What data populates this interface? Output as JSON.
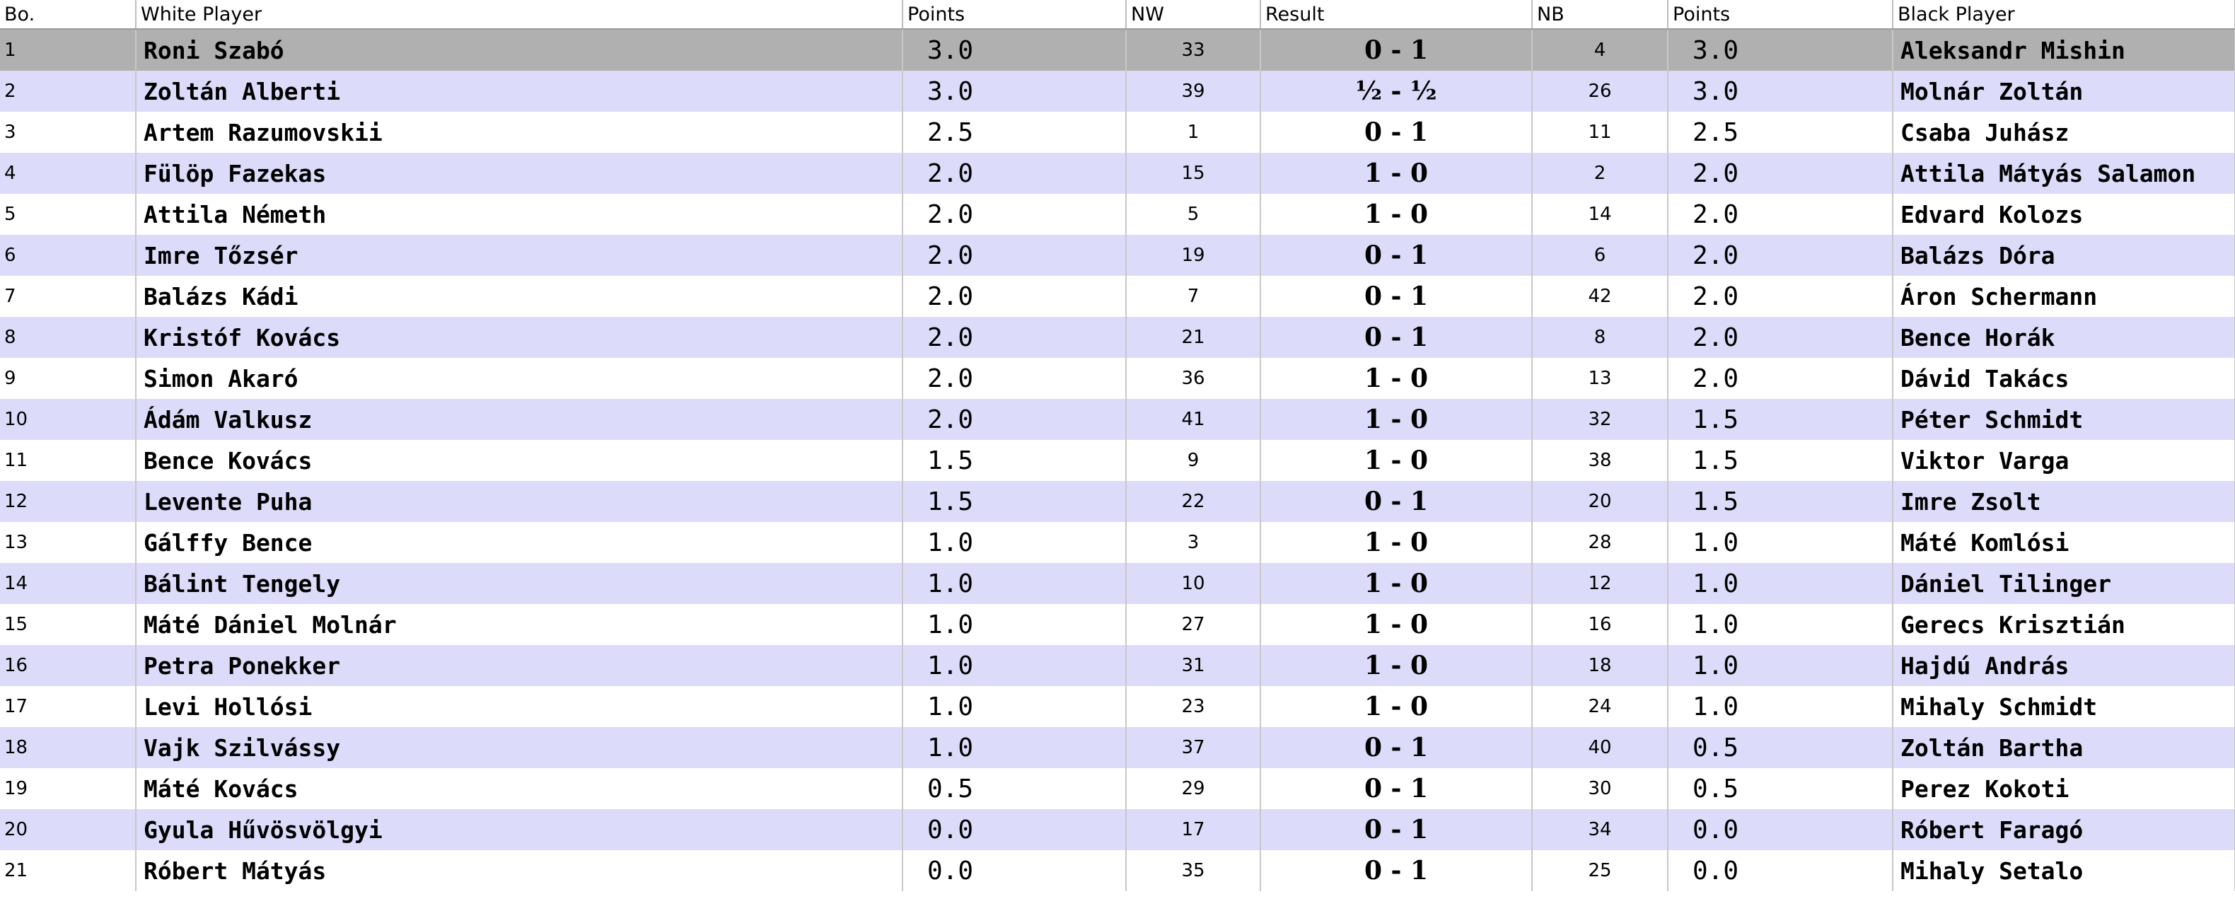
{
  "columns": {
    "board": "Bo.",
    "white_player": "White Player",
    "white_points": "Points",
    "nw": "NW",
    "result": "Result",
    "nb": "NB",
    "black_points": "Points",
    "black_player": "Black Player"
  },
  "selected_row": 0,
  "colors": {
    "row_odd": "#ffffff",
    "row_even": "#dcdcfa",
    "row_selected": "#b0b0b0",
    "grid": "#c8c8c8"
  },
  "rows": [
    {
      "board": "1",
      "white": "Roni Szabó",
      "white_points": "3.0",
      "nw": "33",
      "result": "0 - 1",
      "nb": "4",
      "black_points": "3.0",
      "black": "Aleksandr Mishin"
    },
    {
      "board": "2",
      "white": "Zoltán Alberti",
      "white_points": "3.0",
      "nw": "39",
      "result": "½ - ½",
      "nb": "26",
      "black_points": "3.0",
      "black": "Molnár Zoltán"
    },
    {
      "board": "3",
      "white": "Artem Razumovskii",
      "white_points": "2.5",
      "nw": "1",
      "result": "0 - 1",
      "nb": "11",
      "black_points": "2.5",
      "black": "Csaba Juhász"
    },
    {
      "board": "4",
      "white": "Fülöp Fazekas",
      "white_points": "2.0",
      "nw": "15",
      "result": "1 - 0",
      "nb": "2",
      "black_points": "2.0",
      "black": "Attila Mátyás Salamon"
    },
    {
      "board": "5",
      "white": "Attila Németh",
      "white_points": "2.0",
      "nw": "5",
      "result": "1 - 0",
      "nb": "14",
      "black_points": "2.0",
      "black": "Edvard Kolozs"
    },
    {
      "board": "6",
      "white": "Imre Tőzsér",
      "white_points": "2.0",
      "nw": "19",
      "result": "0 - 1",
      "nb": "6",
      "black_points": "2.0",
      "black": "Balázs Dóra"
    },
    {
      "board": "7",
      "white": "Balázs Kádi",
      "white_points": "2.0",
      "nw": "7",
      "result": "0 - 1",
      "nb": "42",
      "black_points": "2.0",
      "black": "Áron Schermann"
    },
    {
      "board": "8",
      "white": "Kristóf Kovács",
      "white_points": "2.0",
      "nw": "21",
      "result": "0 - 1",
      "nb": "8",
      "black_points": "2.0",
      "black": "Bence Horák"
    },
    {
      "board": "9",
      "white": "Simon Akaró",
      "white_points": "2.0",
      "nw": "36",
      "result": "1 - 0",
      "nb": "13",
      "black_points": "2.0",
      "black": "Dávid Takács"
    },
    {
      "board": "10",
      "white": "Ádám Valkusz",
      "white_points": "2.0",
      "nw": "41",
      "result": "1 - 0",
      "nb": "32",
      "black_points": "1.5",
      "black": "Péter Schmidt"
    },
    {
      "board": "11",
      "white": "Bence Kovács",
      "white_points": "1.5",
      "nw": "9",
      "result": "1 - 0",
      "nb": "38",
      "black_points": "1.5",
      "black": "Viktor Varga"
    },
    {
      "board": "12",
      "white": "Levente Puha",
      "white_points": "1.5",
      "nw": "22",
      "result": "0 - 1",
      "nb": "20",
      "black_points": "1.5",
      "black": "Imre Zsolt"
    },
    {
      "board": "13",
      "white": "Gálffy Bence",
      "white_points": "1.0",
      "nw": "3",
      "result": "1 - 0",
      "nb": "28",
      "black_points": "1.0",
      "black": "Máté Komlósi"
    },
    {
      "board": "14",
      "white": "Bálint Tengely",
      "white_points": "1.0",
      "nw": "10",
      "result": "1 - 0",
      "nb": "12",
      "black_points": "1.0",
      "black": "Dániel Tilinger"
    },
    {
      "board": "15",
      "white": "Máté Dániel Molnár",
      "white_points": "1.0",
      "nw": "27",
      "result": "1 - 0",
      "nb": "16",
      "black_points": "1.0",
      "black": "Gerecs Krisztián"
    },
    {
      "board": "16",
      "white": "Petra Ponekker",
      "white_points": "1.0",
      "nw": "31",
      "result": "1 - 0",
      "nb": "18",
      "black_points": "1.0",
      "black": "Hajdú András"
    },
    {
      "board": "17",
      "white": "Levi Hollósi",
      "white_points": "1.0",
      "nw": "23",
      "result": "1 - 0",
      "nb": "24",
      "black_points": "1.0",
      "black": "Mihaly Schmidt"
    },
    {
      "board": "18",
      "white": "Vajk Szilvássy",
      "white_points": "1.0",
      "nw": "37",
      "result": "0 - 1",
      "nb": "40",
      "black_points": "0.5",
      "black": "Zoltán Bartha"
    },
    {
      "board": "19",
      "white": "Máté Kovács",
      "white_points": "0.5",
      "nw": "29",
      "result": "0 - 1",
      "nb": "30",
      "black_points": "0.5",
      "black": "Perez Kokoti"
    },
    {
      "board": "20",
      "white": "Gyula Hűvösvölgyi",
      "white_points": "0.0",
      "nw": "17",
      "result": "0 - 1",
      "nb": "34",
      "black_points": "0.0",
      "black": "Róbert Faragó"
    },
    {
      "board": "21",
      "white": "Róbert Mátyás",
      "white_points": "0.0",
      "nw": "35",
      "result": "0 - 1",
      "nb": "25",
      "black_points": "0.0",
      "black": "Mihaly Setalo"
    }
  ]
}
